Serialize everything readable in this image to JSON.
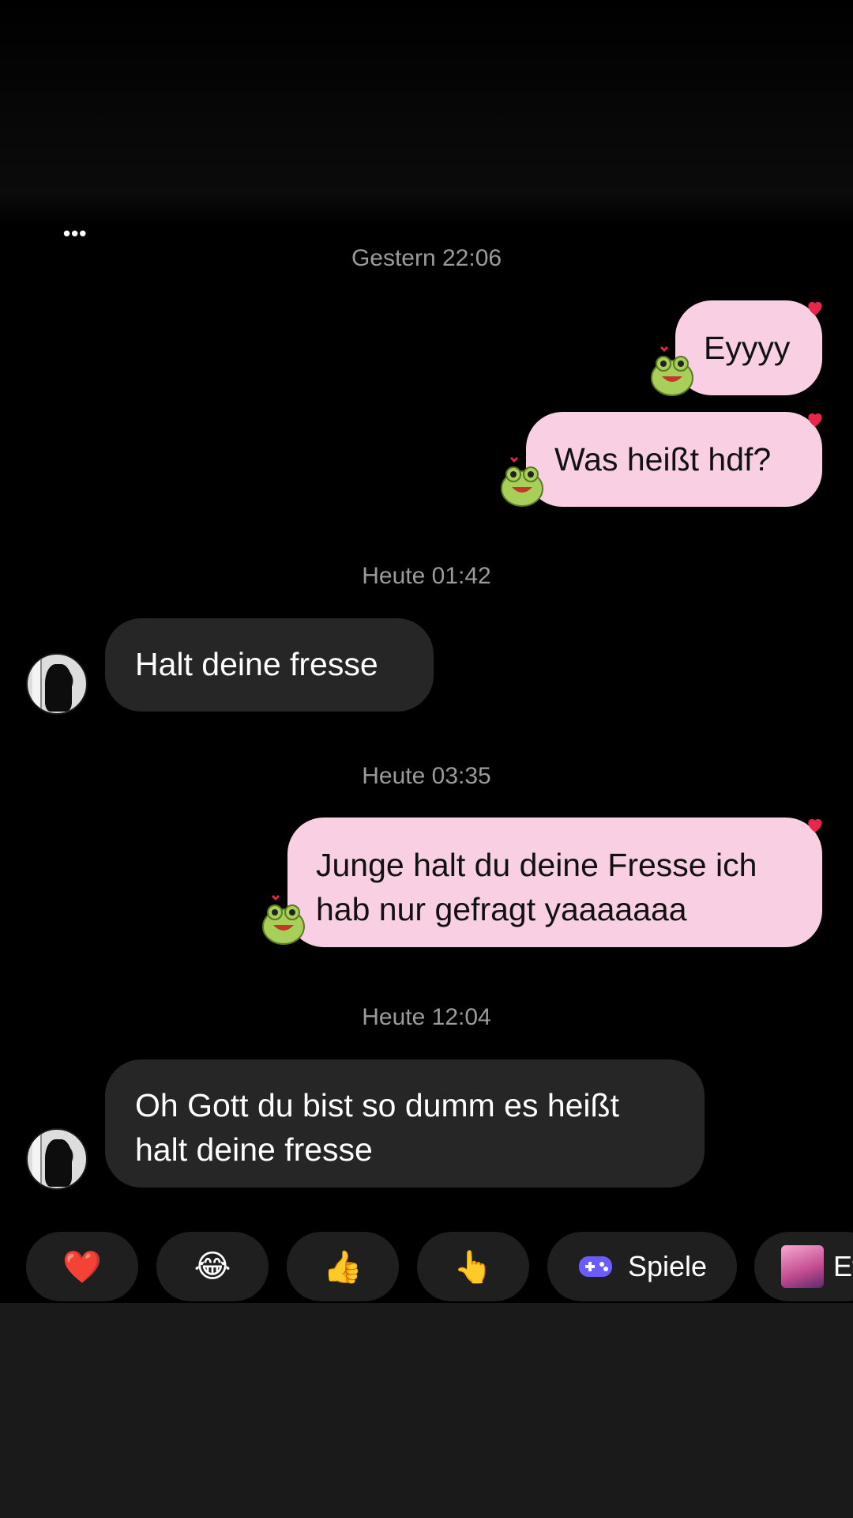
{
  "header": {
    "menu_icon": "more-dots-icon"
  },
  "messages": [
    {
      "type": "timestamp",
      "text": "Gestern 22:06"
    },
    {
      "type": "sent",
      "lines": [
        "Eyyyy"
      ],
      "reaction": "heart"
    },
    {
      "type": "sent",
      "lines": [
        "Was heißt hdf?"
      ],
      "reaction": "heart"
    },
    {
      "type": "timestamp",
      "text": "Heute 01:42"
    },
    {
      "type": "received",
      "lines": [
        "Halt deine fresse"
      ]
    },
    {
      "type": "timestamp",
      "text": "Heute 03:35"
    },
    {
      "type": "sent",
      "lines": [
        "Junge halt du deine Fresse ich",
        "hab nur gefragt yaaaaaaa"
      ],
      "reaction": "heart"
    },
    {
      "type": "timestamp",
      "text": "Heute 12:04"
    },
    {
      "type": "received",
      "lines": [
        "Oh Gott du bist so dumm es heißt",
        "halt deine fresse"
      ]
    }
  ],
  "quick_replies": [
    {
      "emoji": "❤️",
      "name": "heart-emoji"
    },
    {
      "emoji": "😂",
      "name": "laughing-emoji"
    },
    {
      "emoji": "👍",
      "name": "thumbs-up-emoji"
    },
    {
      "emoji": "👆",
      "name": "pointing-up-emoji"
    },
    {
      "label": "Spiele",
      "icon": "gamepad-icon"
    },
    {
      "label": "Ef",
      "icon": "effects-thumbnail-icon"
    }
  ],
  "colors": {
    "sent_bubble": "#f8cfe3",
    "received_bubble": "#262626",
    "timestamp": "#9b9b9b",
    "heart": "#e8264b",
    "gamepad": "#6b5cff"
  }
}
